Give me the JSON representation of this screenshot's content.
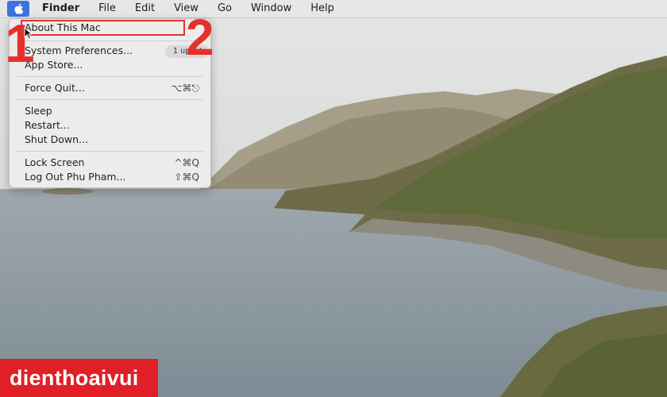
{
  "menubar": {
    "app_name": "Finder",
    "menus": [
      "File",
      "Edit",
      "View",
      "Go",
      "Window",
      "Help"
    ]
  },
  "apple_menu": {
    "items": {
      "about": "About This Mac",
      "system_prefs": "System Preferences...",
      "system_prefs_badge": "1 update",
      "app_store": "App Store...",
      "force_quit": "Force Quit...",
      "force_quit_shortcut": "⌥⌘⎋",
      "sleep": "Sleep",
      "restart": "Restart...",
      "shut_down": "Shut Down...",
      "lock_screen": "Lock Screen",
      "lock_screen_shortcut": "^⌘Q",
      "log_out": "Log Out Phu Pham...",
      "log_out_shortcut": "⇧⌘Q"
    }
  },
  "annotations": {
    "step1": "1",
    "step2": "2",
    "highlight_color": "#e4312b"
  },
  "watermark": {
    "text": "dienthoaivui",
    "color": "#e01f26"
  },
  "colors": {
    "menu_highlight": "#3d73df",
    "water": "#8e9aa3",
    "sky": "#d9dcda"
  }
}
